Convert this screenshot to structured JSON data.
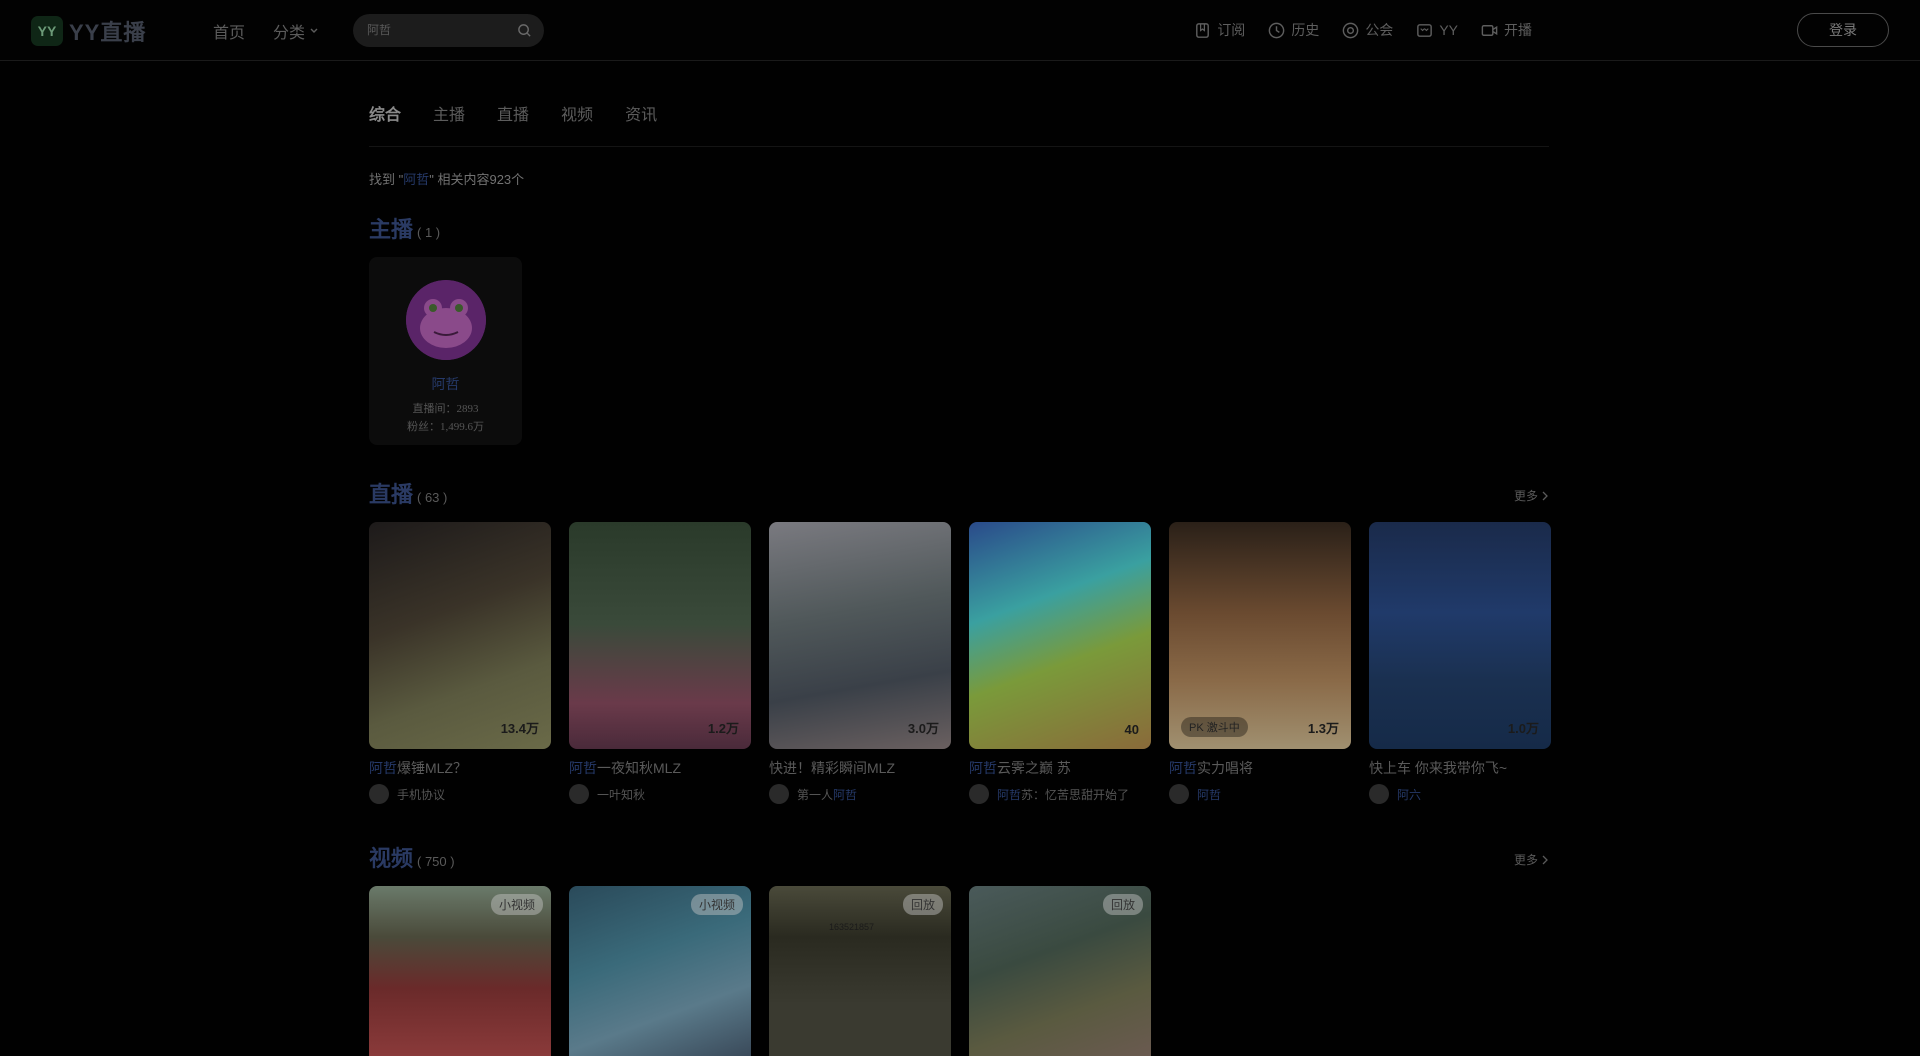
{
  "header": {
    "logo_mark": "YY",
    "logo_text": "YY直播",
    "nav": [
      "首页",
      "分类"
    ],
    "search": {
      "value": "阿哲",
      "placeholder": "阿哲"
    },
    "right_nav": [
      "订阅",
      "历史",
      "公会",
      "YY",
      "开播"
    ],
    "login": "登录"
  },
  "tabs": [
    "综合",
    "主播",
    "直播",
    "视频",
    "资讯"
  ],
  "found": {
    "prefix": "找到 \"",
    "keyword": "阿哲",
    "suffix": "\" 相关内容923个"
  },
  "streamer_section": {
    "title": "主播",
    "count": "( 1 )",
    "card": {
      "name": "阿哲",
      "room": "直播间：2893",
      "fans": "粉丝：1,499.6万"
    }
  },
  "live_section": {
    "title": "直播",
    "count": "( 63 )",
    "more": "更多",
    "cards": [
      {
        "title_hl": "阿哲",
        "title_rest": "爆锤MLZ？",
        "viewers": "13.4万",
        "user_hl": "",
        "user": "手机协议",
        "bg": "linear-gradient(160deg,#1d1a1a 0%,#3a3328 40%,#5a5a3f 70%,#6a6a48 100%)"
      },
      {
        "title_hl": "阿哲",
        "title_rest": "一夜知秋MLZ",
        "viewers": "1.2万",
        "user_hl": "",
        "user": "一叶知秋",
        "bg": "linear-gradient(180deg,#2a3a2a 0%,#3a4a3a 45%,#6a3a4a 80%,#4a2a3a 100%)"
      },
      {
        "title_hl": "",
        "title_rest": "快进！精彩瞬间MLZ",
        "viewers": "3.0万",
        "user_hl": "阿哲",
        "user": "第一人",
        "bg": "linear-gradient(170deg,#7a7a80 0%,#50585a 40%,#3a4048 70%,#6a6060 100%)"
      },
      {
        "title_hl": "阿哲",
        "title_rest": "云霁之巅 苏",
        "viewers": "40",
        "user_hl": "阿哲",
        "user": "苏：忆苦思甜开始了",
        "bg": "linear-gradient(160deg,#2a4a8a 0%,#3aa0a0 35%,#7a9a3a 60%,#8a6a3a 100%)"
      },
      {
        "title_hl": "阿哲",
        "title_rest": "实力唱将",
        "viewers": "1.3万",
        "tag": "PK 激斗中",
        "user_hl": "阿哲",
        "user": "",
        "bg": "linear-gradient(180deg,#2a2018 0%,#6a4a30 40%,#8a6a48 70%,#a09070 100%)"
      },
      {
        "title_hl": "",
        "title_rest": "快上车 你来我带你飞~",
        "viewers": "1.0万",
        "user_hl": "阿六",
        "user": "",
        "bg": "linear-gradient(180deg,#1a2a4a 0%,#203a6a 40%,#1a3050 70%,#152a48 100%)"
      }
    ]
  },
  "video_section": {
    "title": "视频",
    "count": "( 750 )",
    "more": "更多",
    "cards": [
      {
        "tag": "小视频",
        "bg": "linear-gradient(180deg,#6a7a6a 0%,#4a4a3a 30%,#6a2a2a 60%,#8a3a3a 100%)"
      },
      {
        "tag": "小视频",
        "bg": "linear-gradient(160deg,#2a4a5a 0%,#3a6a7a 40%,#5a7a8a 70%,#3a4a5a 100%)"
      },
      {
        "tag": "回放",
        "id_text": "163521857",
        "bg": "linear-gradient(180deg,#4a4a3a 0%,#2a2a20 30%,#3a3a30 70%,#3a3a30 100%)"
      },
      {
        "tag": "回放",
        "bg": "linear-gradient(160deg,#4a5a5a 0%,#3a4a40 40%,#5a5a40 70%,#6a5a50 100%)"
      }
    ]
  },
  "colors": {
    "highlight": "#263a6a",
    "background": "#010101"
  }
}
